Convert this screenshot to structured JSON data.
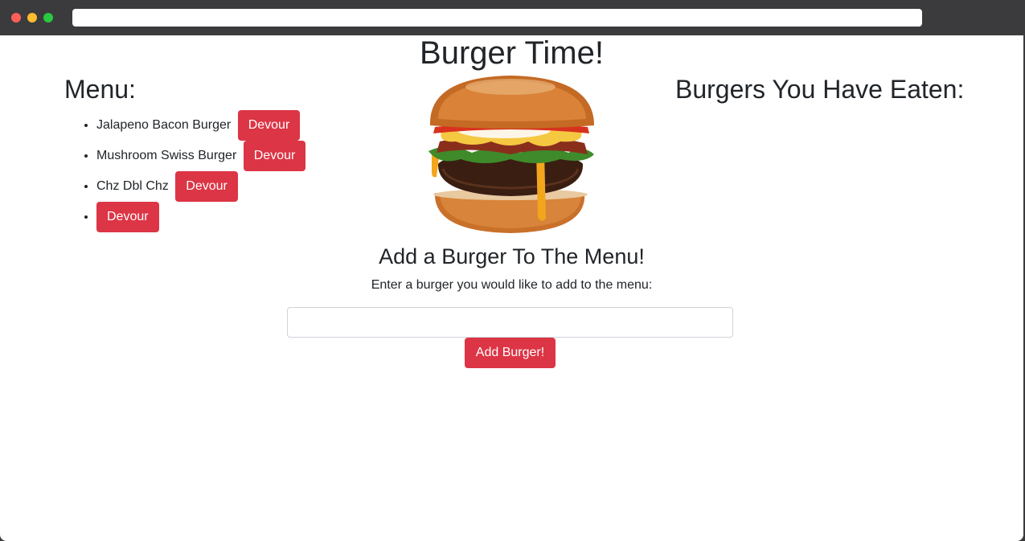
{
  "page": {
    "title": "Burger Time!"
  },
  "menu": {
    "heading": "Menu:",
    "items": [
      {
        "name": "Jalapeno Bacon Burger",
        "button_label": "Devour"
      },
      {
        "name": "Mushroom Swiss Burger",
        "button_label": "Devour"
      },
      {
        "name": "Chz Dbl Chz",
        "button_label": "Devour"
      },
      {
        "name": "",
        "button_label": "Devour"
      }
    ]
  },
  "eaten": {
    "heading": "Burgers You Have Eaten:"
  },
  "burger_image": {
    "icon": "burger-image"
  },
  "add_form": {
    "heading": "Add a Burger To The Menu!",
    "label": "Enter a burger you would like to add to the menu:",
    "input_value": "",
    "input_placeholder": "",
    "submit_label": "Add Burger!"
  },
  "colors": {
    "button_red": "#dc3545",
    "browser_chrome": "#3b3b3d",
    "text": "#212529"
  }
}
